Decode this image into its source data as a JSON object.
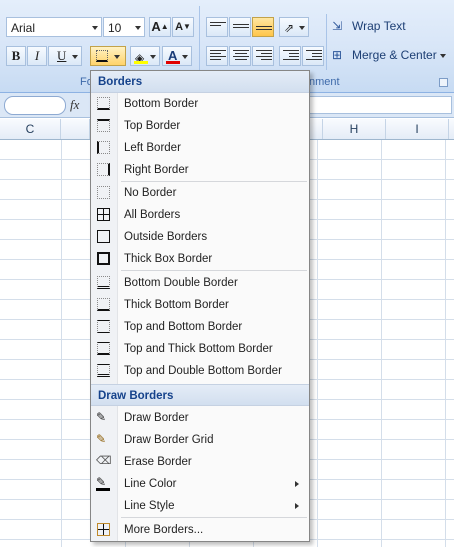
{
  "ribbon": {
    "font_name": "Arial",
    "font_size": "10",
    "bold_label": "B",
    "italic_label": "I",
    "underline_label": "U",
    "grow_font_label": "A",
    "shrink_font_label": "A",
    "font_color_label": "A",
    "font_group_label_left": "Fo",
    "alignment_group_label_right": "nment",
    "wrap_text_label": "Wrap Text",
    "merge_center_label": "Merge & Center"
  },
  "formula_bar": {
    "fx_label": "fx"
  },
  "columns": [
    "C",
    "H",
    "I"
  ],
  "menu": {
    "borders_header": "Borders",
    "borders_items": [
      {
        "label": "Bottom Border",
        "icon": "bottom-border-icon"
      },
      {
        "label": "Top Border",
        "icon": "top-border-icon"
      },
      {
        "label": "Left Border",
        "icon": "left-border-icon"
      },
      {
        "label": "Right Border",
        "icon": "right-border-icon"
      },
      {
        "label": "No Border",
        "icon": "no-border-icon"
      },
      {
        "label": "All Borders",
        "icon": "all-borders-icon"
      },
      {
        "label": "Outside Borders",
        "icon": "outside-borders-icon"
      },
      {
        "label": "Thick Box Border",
        "icon": "thick-box-border-icon"
      },
      {
        "label": "Bottom Double Border",
        "icon": "bottom-double-border-icon"
      },
      {
        "label": "Thick Bottom Border",
        "icon": "thick-bottom-border-icon"
      },
      {
        "label": "Top and Bottom Border",
        "icon": "top-and-bottom-border-icon"
      },
      {
        "label": "Top and Thick Bottom Border",
        "icon": "top-thick-bottom-border-icon"
      },
      {
        "label": "Top and Double Bottom Border",
        "icon": "top-double-bottom-border-icon"
      }
    ],
    "draw_header": "Draw Borders",
    "draw_items": [
      {
        "label": "Draw Border",
        "icon": "pencil-icon"
      },
      {
        "label": "Draw Border Grid",
        "icon": "pencil-grid-icon"
      },
      {
        "label": "Erase Border",
        "icon": "eraser-icon"
      },
      {
        "label": "Line Color",
        "icon": "line-color-icon"
      },
      {
        "label": "Line Style",
        "icon": ""
      },
      {
        "label": "More Borders...",
        "icon": "more-borders-icon"
      }
    ]
  },
  "colors": {
    "header_text": "#15428b",
    "ribbon_accent": "#3e6aaa",
    "font_color_bar": "#e00000",
    "fill_color_bar": "#ffff00",
    "line_color_bar": "#000000"
  }
}
